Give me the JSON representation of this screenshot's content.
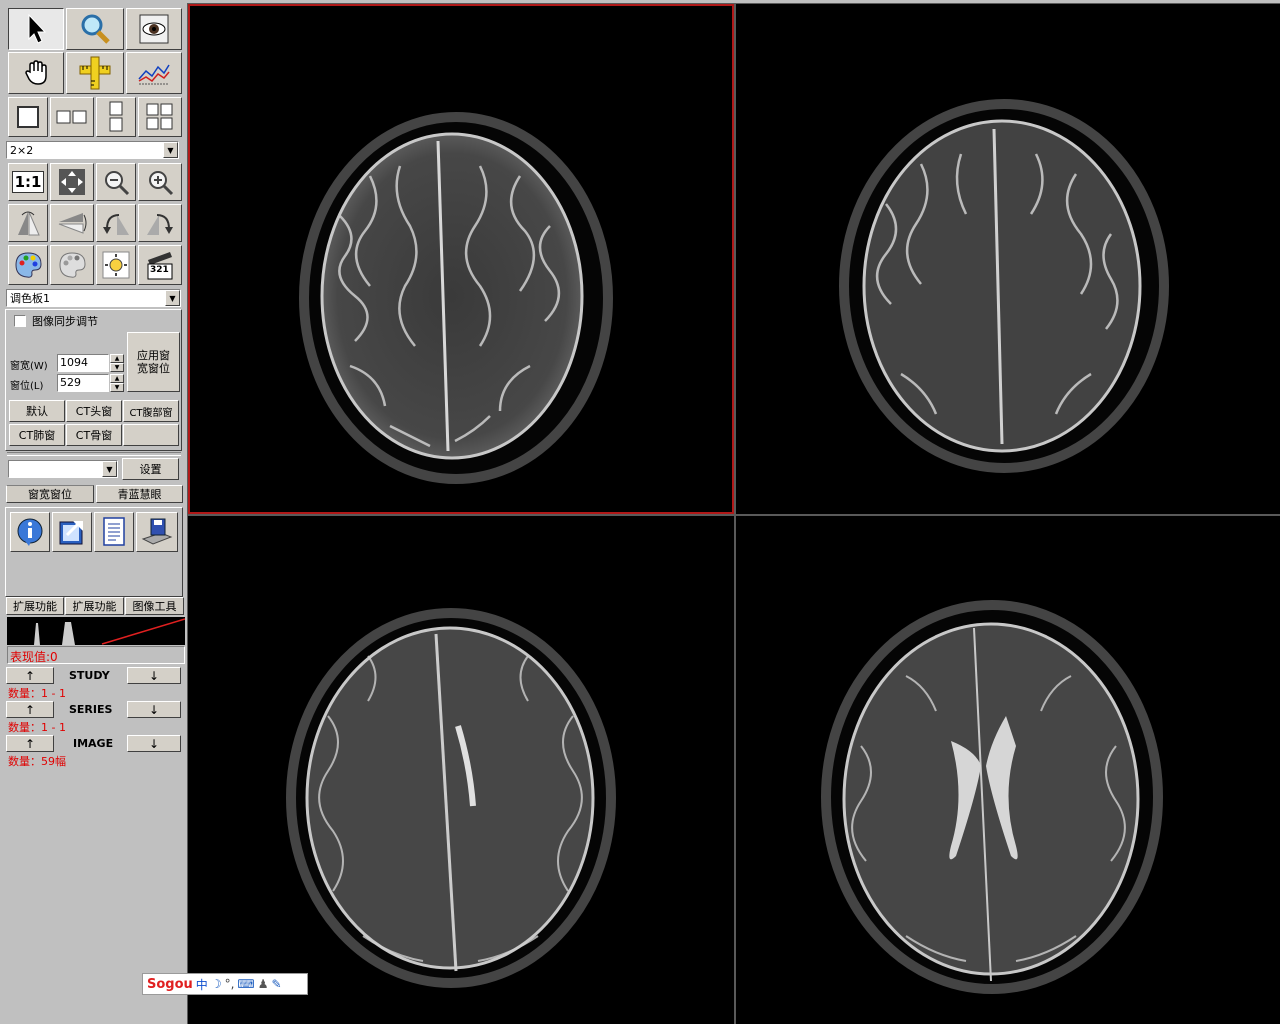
{
  "layout_select": "2×2",
  "palette_select": "调色板1",
  "sync_checkbox_label": "图像同步调节",
  "window_width_label": "窗宽(W)",
  "window_width_value": "1094",
  "window_level_label": "窗位(L)",
  "window_level_value": "529",
  "apply_button": [
    "应用窗",
    "宽窗位"
  ],
  "presets": [
    "默认",
    "CT头窗",
    "CT腹部窗",
    "CT肺窗",
    "CT骨窗",
    ""
  ],
  "settings_button": "设置",
  "settings_select": "",
  "upper_tabs": [
    "窗宽窗位",
    "青蓝慧眼"
  ],
  "lower_tabs": [
    "扩展功能",
    "扩展功能",
    "图像工具"
  ],
  "tool_1to1": "1:1",
  "tool_321": "321",
  "value_readout": "表现值:0",
  "nav": [
    {
      "label": "STUDY",
      "count": "数量：1 - 1"
    },
    {
      "label": "SERIES",
      "count": "数量：1 - 1"
    },
    {
      "label": "IMAGE",
      "count": "数量：59幅"
    }
  ],
  "nav_up": "↑",
  "nav_down": "↓",
  "ime": {
    "logo": "Sogou",
    "mode": "中"
  },
  "colors": {
    "active_border": "#b01818",
    "readout_red": "#e00000",
    "panel": "#c0c0c0"
  }
}
